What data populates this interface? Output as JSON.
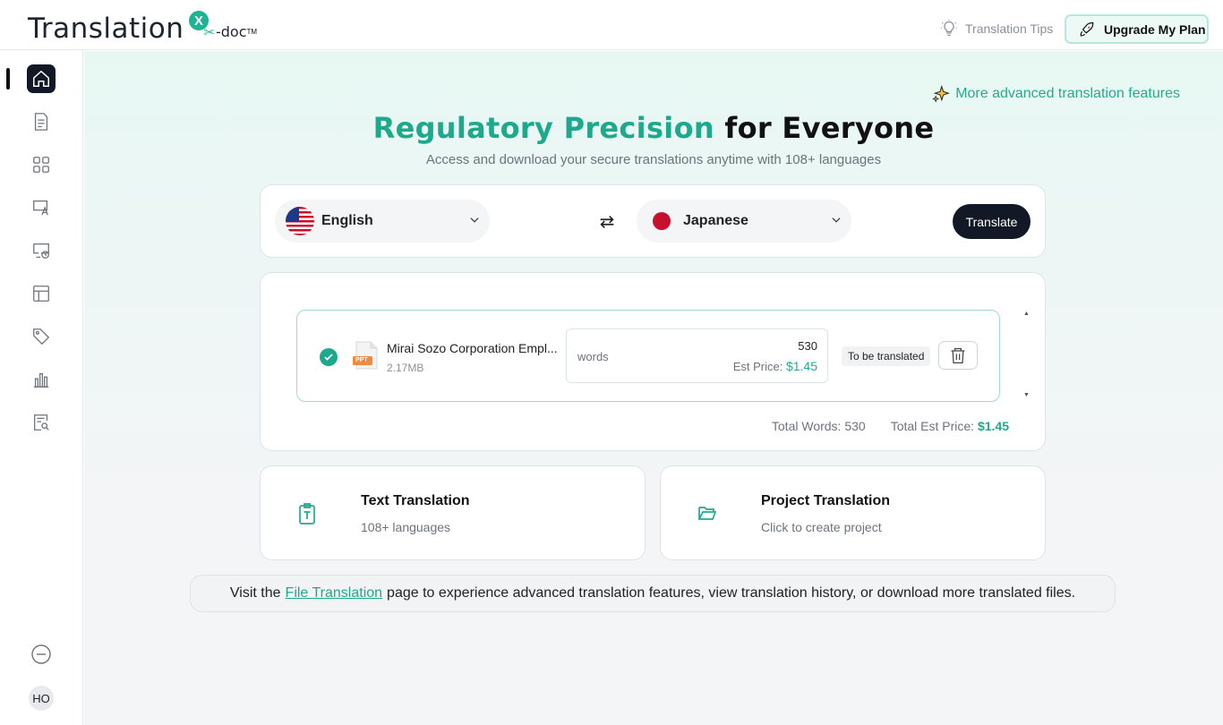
{
  "brand": {
    "logo_main": "Translation",
    "logo_badge": "X",
    "logo_sub": "-doc",
    "logo_tm": "TM"
  },
  "header": {
    "tips_label": "Translation Tips",
    "upgrade_label": "Upgrade My Plan"
  },
  "sidebar": {
    "items": [
      {
        "icon": "home-icon",
        "active": true
      },
      {
        "icon": "document-icon"
      },
      {
        "icon": "grid-icon"
      },
      {
        "icon": "screen-translate-icon"
      },
      {
        "icon": "history-icon"
      },
      {
        "icon": "layout-icon"
      },
      {
        "icon": "tag-icon"
      },
      {
        "icon": "chart-icon"
      },
      {
        "icon": "search-document-icon"
      }
    ],
    "collapse_icon": "minus-circle-icon",
    "avatar_initials": "HO"
  },
  "main": {
    "advanced_link": "More advanced translation features",
    "title_accent": "Regulatory Precision",
    "title_rest": "for Everyone",
    "subtitle": "Access and download your secure translations anytime with 108+ languages",
    "source_language": "English",
    "target_language": "Japanese",
    "translate_label": "Translate",
    "file": {
      "name": "Mirai Sozo Corporation Empl...",
      "size": "2.17MB",
      "type_label": "PPT",
      "words_label": "words",
      "word_count": "530",
      "est_label": "Est Price:",
      "est_price": "$1.45",
      "status": "To be translated"
    },
    "totals": {
      "words_label": "Total Words:",
      "words_value": "530",
      "price_label": "Total Est Price:",
      "price_value": "$1.45"
    },
    "options": [
      {
        "title": "Text Translation",
        "subtitle": "108+ languages",
        "icon": "clipboard-text-icon"
      },
      {
        "title": "Project Translation",
        "subtitle": "Click to create project",
        "icon": "folder-open-icon"
      }
    ],
    "footer": {
      "prefix": "Visit the",
      "link": "File Translation",
      "suffix": "page to experience advanced translation features, view translation history, or download more translated files."
    }
  },
  "colors": {
    "accent": "#1fa98c",
    "dark": "#121826"
  }
}
